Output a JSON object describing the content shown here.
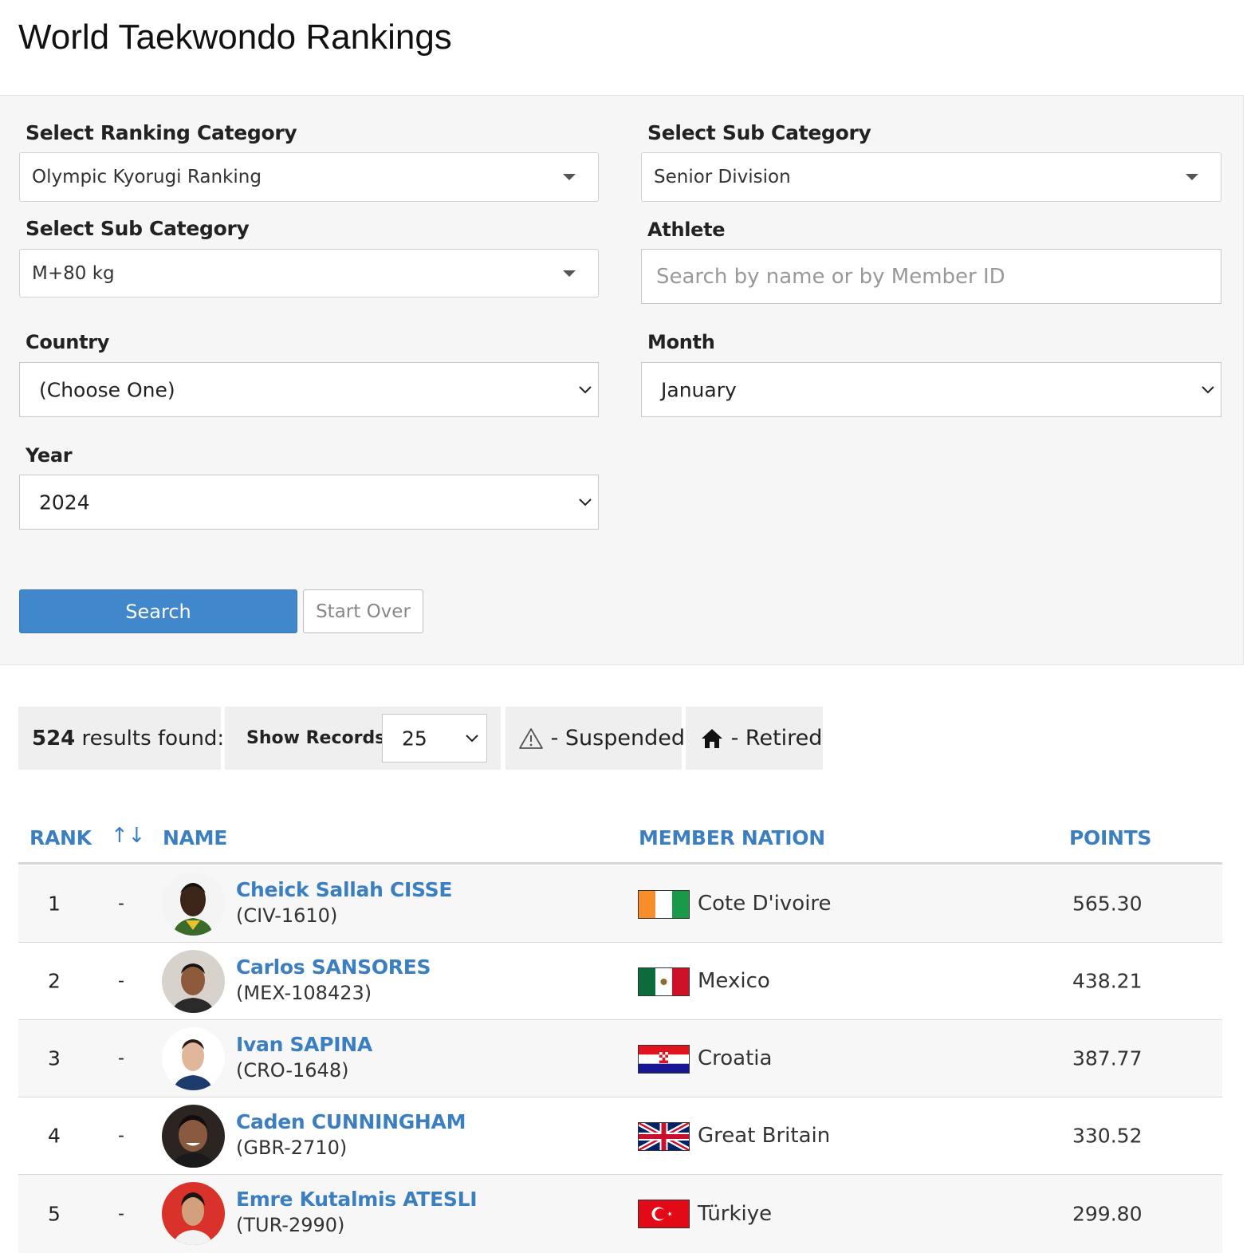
{
  "page_title": "World Taekwondo Rankings",
  "filters": {
    "ranking_category": {
      "label": "Select Ranking Category",
      "value": "Olympic Kyorugi Ranking"
    },
    "sub_category_1": {
      "label": "Select Sub Category",
      "value": "Senior Division"
    },
    "sub_category_2": {
      "label": "Select Sub Category",
      "value": "M+80 kg"
    },
    "athlete": {
      "label": "Athlete",
      "placeholder": "Search by name or by Member ID"
    },
    "country": {
      "label": "Country",
      "value": "(Choose One)"
    },
    "month": {
      "label": "Month",
      "value": "January"
    },
    "year": {
      "label": "Year",
      "value": "2024"
    },
    "search_button": "Search",
    "start_over_button": "Start Over"
  },
  "toolbar": {
    "results_count": "524",
    "results_suffix": " results found:",
    "show_records_label": "Show Records:",
    "show_records_value": "25",
    "suspended_label": " - Suspended",
    "retired_label": " - Retired"
  },
  "table": {
    "headers": {
      "rank": "RANK",
      "sort": "↑↓",
      "name": "NAME",
      "nation": "MEMBER NATION",
      "points": "POINTS"
    },
    "rows": [
      {
        "rank": "1",
        "move": "-",
        "name": "Cheick Sallah CISSE",
        "member_id": "(CIV-1610)",
        "nation": "Cote D'ivoire",
        "points": "565.30"
      },
      {
        "rank": "2",
        "move": "-",
        "name": "Carlos SANSORES",
        "member_id": "(MEX-108423)",
        "nation": "Mexico",
        "points": "438.21"
      },
      {
        "rank": "3",
        "move": "-",
        "name": "Ivan SAPINA",
        "member_id": "(CRO-1648)",
        "nation": "Croatia",
        "points": "387.77"
      },
      {
        "rank": "4",
        "move": "-",
        "name": "Caden CUNNINGHAM",
        "member_id": "(GBR-2710)",
        "nation": "Great Britain",
        "points": "330.52"
      },
      {
        "rank": "5",
        "move": "-",
        "name": "Emre Kutalmis ATESLI",
        "member_id": "(TUR-2990)",
        "nation": "Türkiye",
        "points": "299.80"
      }
    ]
  },
  "colors": {
    "link_blue": "#3b7fc1",
    "button_blue": "#4187cc",
    "panel_gray": "#f6f6f6"
  }
}
